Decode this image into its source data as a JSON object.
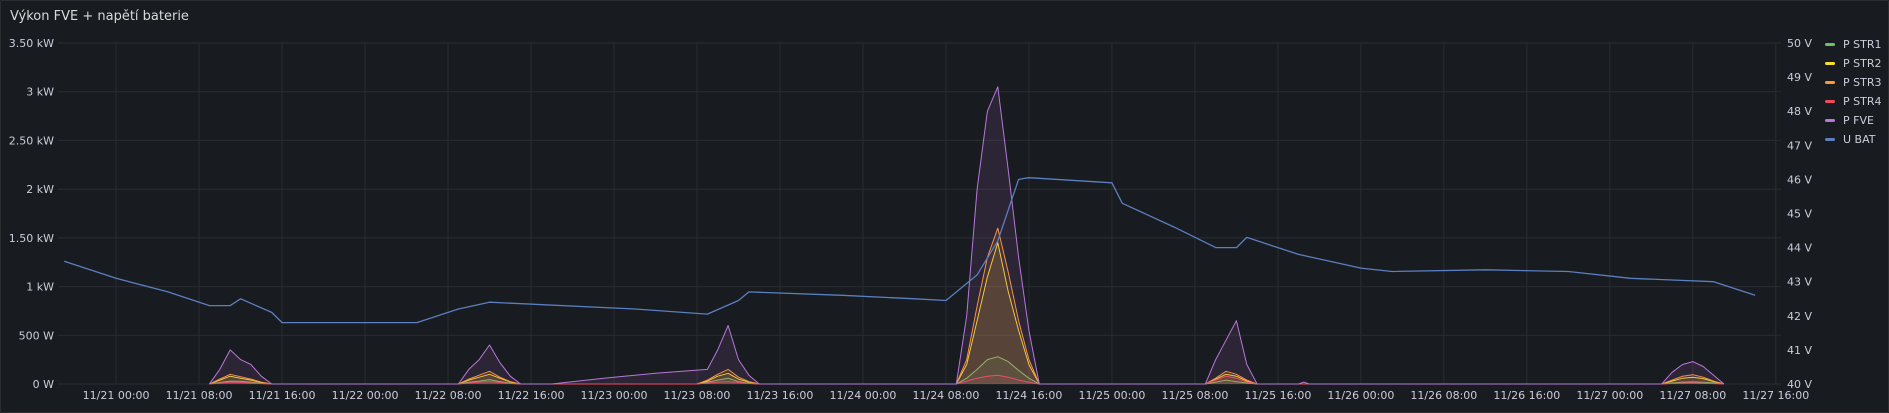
{
  "panel": {
    "title": "Výkon FVE + napětí baterie"
  },
  "chart_data": {
    "type": "line",
    "title": "Výkon FVE + napětí baterie",
    "x_ticks": [
      "11/21 00:00",
      "11/21 08:00",
      "11/21 16:00",
      "11/22 00:00",
      "11/22 08:00",
      "11/22 16:00",
      "11/23 00:00",
      "11/23 08:00",
      "11/23 16:00",
      "11/24 00:00",
      "11/24 08:00",
      "11/24 16:00",
      "11/25 00:00",
      "11/25 08:00",
      "11/25 16:00",
      "11/26 00:00",
      "11/26 08:00",
      "11/26 16:00",
      "11/27 00:00",
      "11/27 08:00",
      "11/27 16:00"
    ],
    "xlim_hours": [
      -5.6,
      160.5
    ],
    "y_left": {
      "ticks": [
        "0 W",
        "500 W",
        "1 kW",
        "1.50 kW",
        "2 kW",
        "2.50 kW",
        "3 kW",
        "3.50 kW"
      ],
      "ylim": [
        0,
        3500
      ],
      "unit": "W"
    },
    "y_right": {
      "ticks": [
        "40 V",
        "41 V",
        "42 V",
        "43 V",
        "44 V",
        "45 V",
        "46 V",
        "47 V",
        "48 V",
        "49 V",
        "50 V"
      ],
      "ylim": [
        40,
        50
      ],
      "unit": "V"
    },
    "grid": true,
    "legend_position": "right",
    "series": [
      {
        "name": "P STR1",
        "axis": "left",
        "color": "#73bf69",
        "points": [
          [
            9,
            0
          ],
          [
            10,
            15
          ],
          [
            11,
            30
          ],
          [
            12,
            28
          ],
          [
            13,
            18
          ],
          [
            14,
            6
          ],
          [
            15,
            0
          ],
          [
            33,
            0
          ],
          [
            34,
            18
          ],
          [
            35,
            30
          ],
          [
            36,
            45
          ],
          [
            37,
            25
          ],
          [
            38,
            8
          ],
          [
            39,
            0
          ],
          [
            56,
            0
          ],
          [
            57,
            20
          ],
          [
            58,
            40
          ],
          [
            59,
            60
          ],
          [
            60,
            25
          ],
          [
            61,
            8
          ],
          [
            62,
            0
          ],
          [
            81,
            0
          ],
          [
            82,
            60
          ],
          [
            83,
            150
          ],
          [
            84,
            250
          ],
          [
            85,
            280
          ],
          [
            86,
            230
          ],
          [
            87,
            140
          ],
          [
            88,
            60
          ],
          [
            89,
            0
          ],
          [
            105,
            0
          ],
          [
            106,
            20
          ],
          [
            107,
            40
          ],
          [
            108,
            25
          ],
          [
            109,
            10
          ],
          [
            110,
            0
          ],
          [
            149,
            0
          ],
          [
            150,
            10
          ],
          [
            151,
            20
          ],
          [
            152,
            22
          ],
          [
            153,
            18
          ],
          [
            154,
            10
          ],
          [
            155,
            0
          ]
        ]
      },
      {
        "name": "P STR2",
        "axis": "left",
        "color": "#fade2a",
        "points": [
          [
            9,
            0
          ],
          [
            10,
            40
          ],
          [
            11,
            80
          ],
          [
            12,
            60
          ],
          [
            13,
            40
          ],
          [
            14,
            15
          ],
          [
            15,
            0
          ],
          [
            33,
            0
          ],
          [
            34,
            40
          ],
          [
            35,
            70
          ],
          [
            36,
            100
          ],
          [
            37,
            60
          ],
          [
            38,
            20
          ],
          [
            39,
            0
          ],
          [
            56,
            0
          ],
          [
            57,
            30
          ],
          [
            58,
            80
          ],
          [
            59,
            110
          ],
          [
            60,
            50
          ],
          [
            61,
            20
          ],
          [
            62,
            0
          ],
          [
            81,
            0
          ],
          [
            82,
            200
          ],
          [
            83,
            650
          ],
          [
            84,
            1100
          ],
          [
            85,
            1450
          ],
          [
            86,
            950
          ],
          [
            87,
            550
          ],
          [
            88,
            200
          ],
          [
            89,
            0
          ],
          [
            105,
            0
          ],
          [
            106,
            50
          ],
          [
            107,
            100
          ],
          [
            108,
            80
          ],
          [
            109,
            30
          ],
          [
            110,
            0
          ],
          [
            149,
            0
          ],
          [
            150,
            30
          ],
          [
            151,
            60
          ],
          [
            152,
            70
          ],
          [
            153,
            55
          ],
          [
            154,
            25
          ],
          [
            155,
            0
          ]
        ]
      },
      {
        "name": "P STR3",
        "axis": "left",
        "color": "#ff9830",
        "points": [
          [
            9,
            0
          ],
          [
            10,
            50
          ],
          [
            11,
            100
          ],
          [
            12,
            75
          ],
          [
            13,
            50
          ],
          [
            14,
            20
          ],
          [
            15,
            0
          ],
          [
            33,
            0
          ],
          [
            34,
            50
          ],
          [
            35,
            90
          ],
          [
            36,
            130
          ],
          [
            37,
            70
          ],
          [
            38,
            25
          ],
          [
            39,
            0
          ],
          [
            56,
            0
          ],
          [
            57,
            40
          ],
          [
            58,
            100
          ],
          [
            59,
            150
          ],
          [
            60,
            70
          ],
          [
            61,
            25
          ],
          [
            62,
            0
          ],
          [
            81,
            0
          ],
          [
            82,
            250
          ],
          [
            83,
            800
          ],
          [
            84,
            1300
          ],
          [
            85,
            1600
          ],
          [
            86,
            1150
          ],
          [
            87,
            650
          ],
          [
            88,
            250
          ],
          [
            89,
            0
          ],
          [
            105,
            0
          ],
          [
            106,
            60
          ],
          [
            107,
            130
          ],
          [
            108,
            100
          ],
          [
            109,
            40
          ],
          [
            110,
            0
          ],
          [
            149,
            0
          ],
          [
            150,
            40
          ],
          [
            151,
            80
          ],
          [
            152,
            95
          ],
          [
            153,
            70
          ],
          [
            154,
            30
          ],
          [
            155,
            0
          ]
        ]
      },
      {
        "name": "P STR4",
        "axis": "left",
        "color": "#f2495c",
        "points": [
          [
            9,
            0
          ],
          [
            10,
            10
          ],
          [
            11,
            20
          ],
          [
            12,
            15
          ],
          [
            13,
            10
          ],
          [
            14,
            4
          ],
          [
            15,
            0
          ],
          [
            33,
            0
          ],
          [
            34,
            10
          ],
          [
            35,
            20
          ],
          [
            36,
            25
          ],
          [
            37,
            15
          ],
          [
            38,
            5
          ],
          [
            39,
            0
          ],
          [
            56,
            0
          ],
          [
            57,
            10
          ],
          [
            58,
            20
          ],
          [
            59,
            25
          ],
          [
            60,
            15
          ],
          [
            61,
            5
          ],
          [
            62,
            0
          ],
          [
            81,
            0
          ],
          [
            82,
            30
          ],
          [
            83,
            60
          ],
          [
            84,
            80
          ],
          [
            85,
            90
          ],
          [
            86,
            70
          ],
          [
            87,
            40
          ],
          [
            88,
            20
          ],
          [
            89,
            0
          ],
          [
            105,
            0
          ],
          [
            106,
            40
          ],
          [
            107,
            80
          ],
          [
            108,
            60
          ],
          [
            109,
            20
          ],
          [
            110,
            0
          ],
          [
            149,
            0
          ],
          [
            150,
            5
          ],
          [
            151,
            10
          ],
          [
            152,
            12
          ],
          [
            153,
            8
          ],
          [
            154,
            4
          ],
          [
            155,
            0
          ]
        ]
      },
      {
        "name": "P FVE",
        "axis": "left",
        "color": "#b877d9",
        "points": [
          [
            9,
            0
          ],
          [
            10,
            150
          ],
          [
            11,
            350
          ],
          [
            12,
            250
          ],
          [
            13,
            200
          ],
          [
            14,
            80
          ],
          [
            15,
            0
          ],
          [
            33,
            0
          ],
          [
            34,
            150
          ],
          [
            35,
            250
          ],
          [
            36,
            400
          ],
          [
            37,
            220
          ],
          [
            38,
            80
          ],
          [
            39,
            0
          ],
          [
            42,
            0
          ],
          [
            47,
            60
          ],
          [
            52,
            110
          ],
          [
            57,
            150
          ],
          [
            58,
            350
          ],
          [
            59,
            600
          ],
          [
            60,
            250
          ],
          [
            61,
            90
          ],
          [
            62,
            0
          ],
          [
            81,
            0
          ],
          [
            82,
            700
          ],
          [
            83,
            2000
          ],
          [
            84,
            2800
          ],
          [
            85,
            3050
          ],
          [
            86,
            2200
          ],
          [
            87,
            1300
          ],
          [
            88,
            550
          ],
          [
            89,
            0
          ],
          [
            105,
            0
          ],
          [
            106,
            250
          ],
          [
            107,
            450
          ],
          [
            108,
            650
          ],
          [
            109,
            200
          ],
          [
            110,
            0
          ],
          [
            114,
            0
          ],
          [
            114.5,
            20
          ],
          [
            115,
            0
          ],
          [
            149,
            0
          ],
          [
            150,
            120
          ],
          [
            151,
            200
          ],
          [
            152,
            230
          ],
          [
            153,
            180
          ],
          [
            154,
            90
          ],
          [
            155,
            0
          ]
        ]
      },
      {
        "name": "U BAT",
        "axis": "right",
        "color": "#5b7fc1",
        "points": [
          [
            -5,
            43.6
          ],
          [
            0,
            43.1
          ],
          [
            5,
            42.7
          ],
          [
            9,
            42.3
          ],
          [
            11,
            42.3
          ],
          [
            12,
            42.5
          ],
          [
            15,
            42.1
          ],
          [
            16,
            41.8
          ],
          [
            26,
            41.8
          ],
          [
            29,
            41.8
          ],
          [
            33,
            42.2
          ],
          [
            36,
            42.4
          ],
          [
            50,
            42.2
          ],
          [
            57,
            42.05
          ],
          [
            60,
            42.45
          ],
          [
            61,
            42.7
          ],
          [
            70,
            42.6
          ],
          [
            77,
            42.5
          ],
          [
            80,
            42.45
          ],
          [
            83,
            43.2
          ],
          [
            85,
            44.2
          ],
          [
            87,
            46.0
          ],
          [
            88,
            46.05
          ],
          [
            96,
            45.9
          ],
          [
            97,
            45.3
          ],
          [
            102,
            44.6
          ],
          [
            106,
            44.0
          ],
          [
            108,
            44.0
          ],
          [
            109,
            44.3
          ],
          [
            114,
            43.8
          ],
          [
            120,
            43.4
          ],
          [
            123,
            43.3
          ],
          [
            132,
            43.35
          ],
          [
            140,
            43.3
          ],
          [
            146,
            43.1
          ],
          [
            150,
            43.05
          ],
          [
            154,
            43.0
          ],
          [
            158,
            42.6
          ]
        ]
      }
    ]
  }
}
